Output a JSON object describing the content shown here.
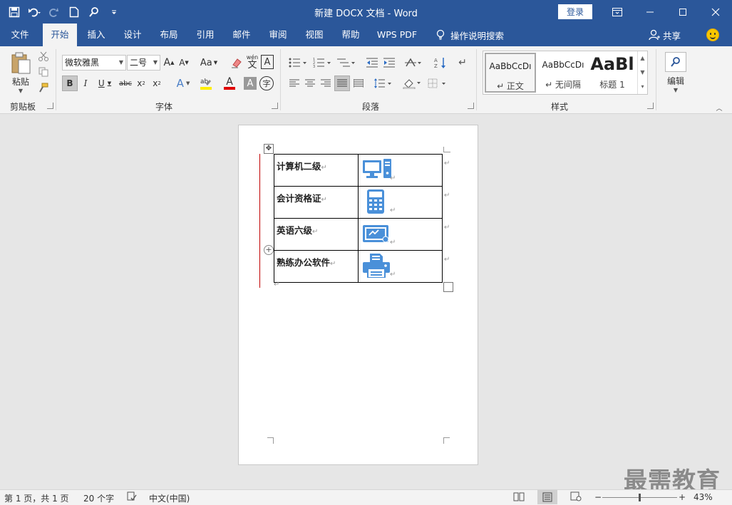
{
  "window": {
    "title": "新建 DOCX 文档  -  Word",
    "login_label": "登录",
    "minimize": "─",
    "restore": "☐",
    "close": "✕"
  },
  "qat": {
    "save": "save-icon",
    "undo": "undo-icon",
    "redo": "redo-icon",
    "new": "new-doc-icon",
    "find": "find-icon",
    "customize": "customize-icon"
  },
  "tabs": [
    {
      "label": "文件"
    },
    {
      "label": "开始"
    },
    {
      "label": "插入"
    },
    {
      "label": "设计"
    },
    {
      "label": "布局"
    },
    {
      "label": "引用"
    },
    {
      "label": "邮件"
    },
    {
      "label": "审阅"
    },
    {
      "label": "视图"
    },
    {
      "label": "帮助"
    },
    {
      "label": "WPS PDF"
    }
  ],
  "tell_me": "操作说明搜索",
  "share": "共享",
  "ribbon": {
    "clipboard": {
      "label": "剪贴板",
      "paste": "粘贴"
    },
    "font": {
      "label": "字体",
      "font_name": "微软雅黑",
      "font_size": "二号",
      "case": "Aa",
      "phonetic": "wén"
    },
    "paragraph": {
      "label": "段落"
    },
    "styles": {
      "label": "样式",
      "items": [
        {
          "sample": "AaBbCcDı",
          "name": "↵ 正文"
        },
        {
          "sample": "AaBbCcDı",
          "name": "↵ 无间隔"
        },
        {
          "sample": "AaBl",
          "name": "标题 1"
        }
      ]
    },
    "editing": {
      "label": "编辑"
    }
  },
  "document": {
    "para_mark": "↵",
    "rows": [
      {
        "label": "计算机二级",
        "icon": "computer-icon"
      },
      {
        "label": "会计资格证",
        "icon": "calculator-icon"
      },
      {
        "label": "英语六级",
        "icon": "certificate-icon"
      },
      {
        "label": "熟练办公软件",
        "icon": "printer-icon"
      }
    ]
  },
  "status": {
    "page": "第 1 页，共 1 页",
    "words": "20 个字",
    "language": "中文(中国)",
    "zoom": "43%",
    "zoom_minus": "−",
    "zoom_plus": "+"
  },
  "watermark": "最需教育",
  "colors": {
    "accent": "#2b579a",
    "icon_blue": "#4a90d9"
  }
}
